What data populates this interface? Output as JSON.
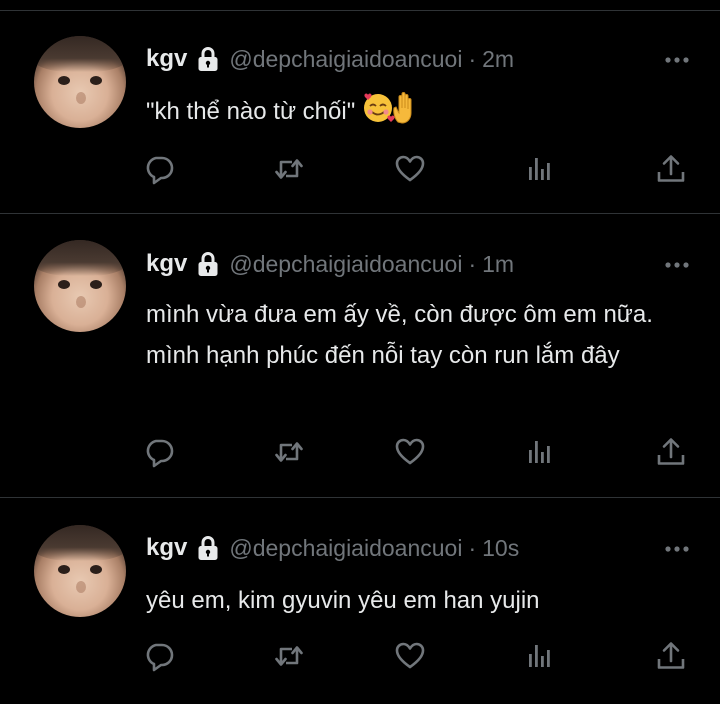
{
  "theme": {
    "background": "#000000",
    "text": "#e7e9ea",
    "muted": "#71767b",
    "divider": "#2f3336"
  },
  "tweets": [
    {
      "display_name": "kgv",
      "handle": "@depchaigiaidoancuoi",
      "separator": "·",
      "time": "2m",
      "text": "\"kh thể nào từ chối\"",
      "emojis": [
        "smiling-face-with-hearts-icon",
        "raised-hand-icon"
      ]
    },
    {
      "display_name": "kgv",
      "handle": "@depchaigiaidoancuoi",
      "separator": "·",
      "time": "1m",
      "text": "mình vừa đưa em ấy về, còn được ôm em nữa. mình hạnh phúc đến nỗi tay còn run lắm đây",
      "emojis": []
    },
    {
      "display_name": "kgv",
      "handle": "@depchaigiaidoancuoi",
      "separator": "·",
      "time": "10s",
      "text": "yêu em, kim gyuvin yêu em han yujin",
      "emojis": []
    }
  ],
  "action_icons": [
    "reply-icon",
    "retweet-icon",
    "like-icon",
    "views-icon",
    "share-icon"
  ]
}
